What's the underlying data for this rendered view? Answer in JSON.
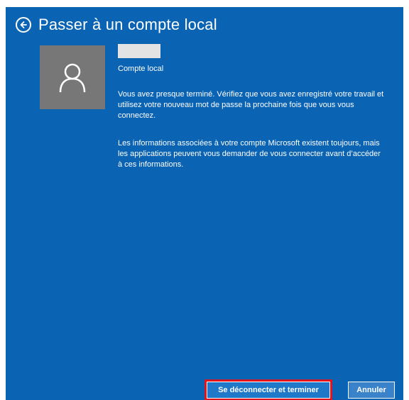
{
  "header": {
    "title": "Passer à un compte local",
    "back_icon": "back-arrow-icon"
  },
  "account": {
    "avatar_icon": "user-icon",
    "type_label": "Compte local"
  },
  "message": {
    "paragraph1": "Vous avez presque terminé. Vérifiez que vous avez enregistré votre travail et utilisez votre nouveau mot de passe la prochaine fois que vous vous connectez.",
    "paragraph2": "Les informations associées à votre compte Microsoft existent toujours, mais les applications peuvent vous demander de vous connecter avant d’accéder à ces informations."
  },
  "footer": {
    "primary_label": "Se déconnecter et terminer",
    "secondary_label": "Annuler"
  },
  "colors": {
    "background": "#0b63b4",
    "highlight": "#e1141c",
    "avatar": "#777777"
  }
}
